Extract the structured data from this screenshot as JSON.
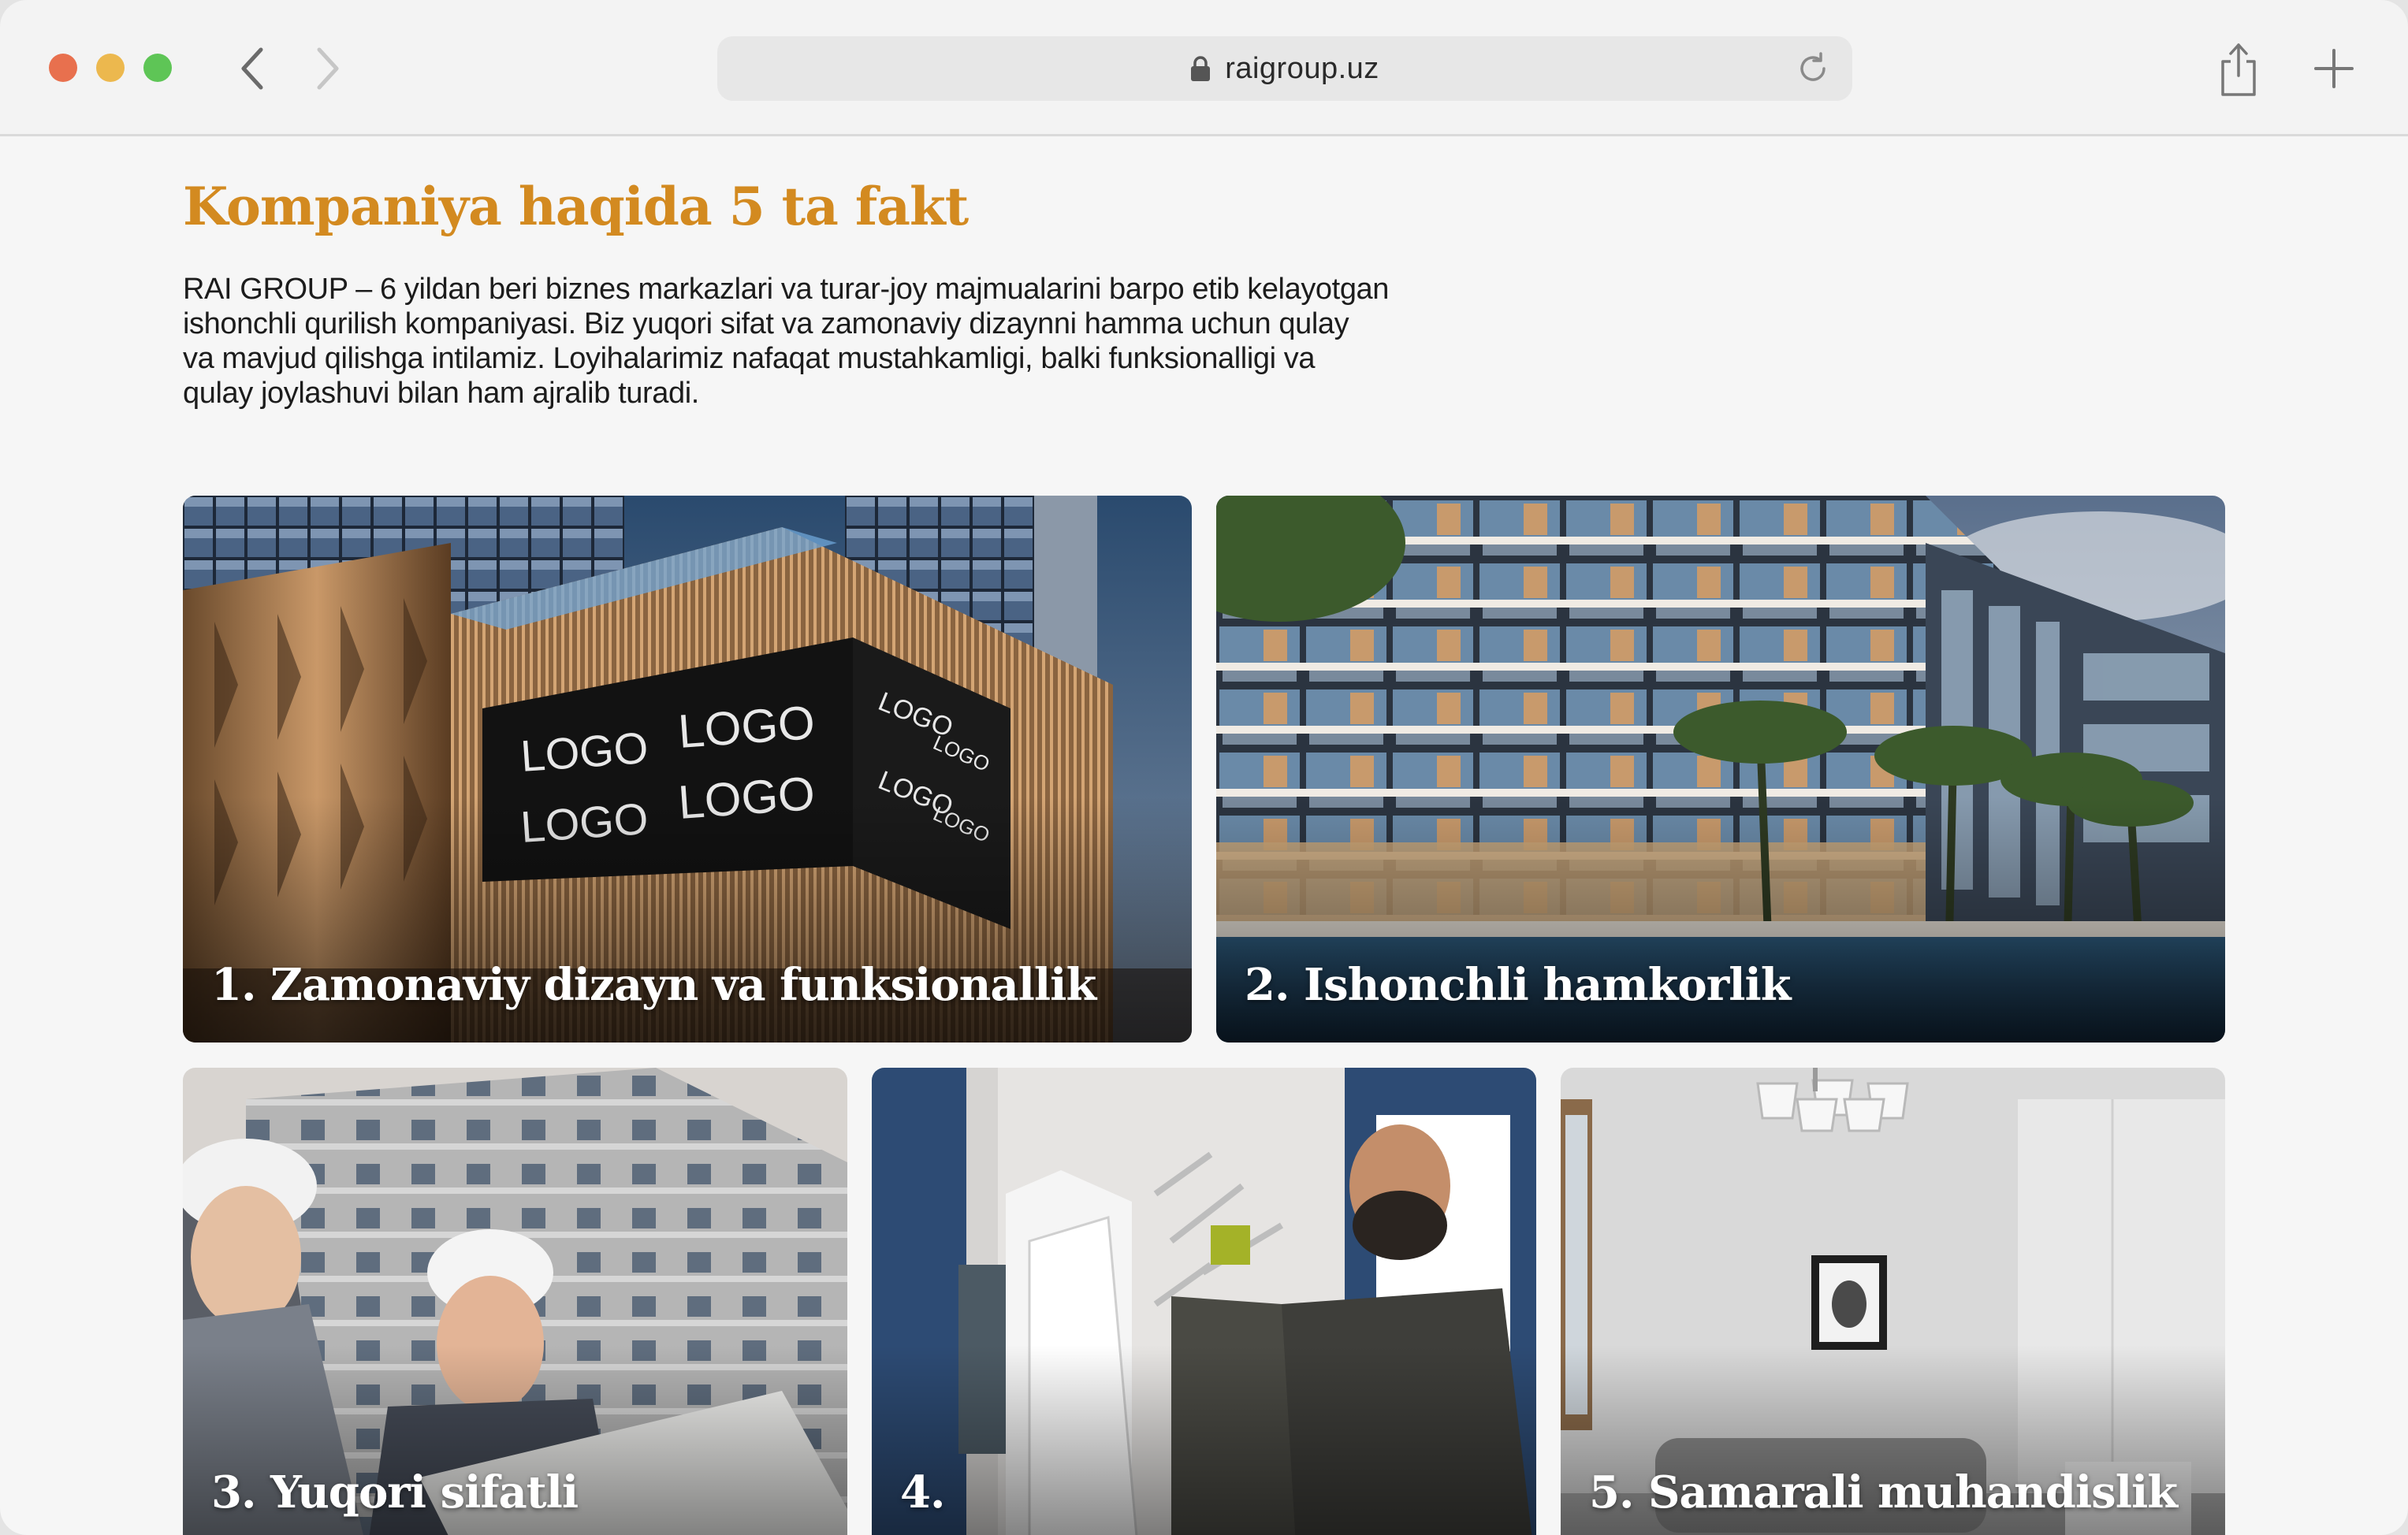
{
  "browser": {
    "url": "raigroup.uz",
    "icons": {
      "back": "chevron-left-icon",
      "forward": "chevron-right-icon",
      "lock": "lock-icon",
      "reload": "reload-icon",
      "share": "share-icon",
      "new_tab": "plus-icon"
    }
  },
  "section": {
    "heading": "Kompaniya haqida 5 ta fakt",
    "intro_lines": [
      "RAI GROUP – 6 yildan beri biznes markazlari va turar-joy majmualarini barpo etib kelayotgan",
      "ishonchli qurilish kompaniyasi. Biz yuqori sifat va zamonaviy dizaynni hamma uchun qulay",
      "va mavjud qilishga intilamiz. Loyihalarimiz nafaqat mustahkamligi, balki funksionalligi va",
      "qulay joylashuvi bilan ham ajralib turadi."
    ],
    "heading_color": "#d38a20"
  },
  "facts": [
    {
      "title": "1. Zamonaviy dizayn va funksionallik",
      "billboard_text": "LOGO"
    },
    {
      "title": "2. Ishonchli hamkorlik"
    },
    {
      "title": "3. Yuqori sifatli"
    },
    {
      "title": "4."
    },
    {
      "title": "5. Samarali muhandislik"
    }
  ]
}
